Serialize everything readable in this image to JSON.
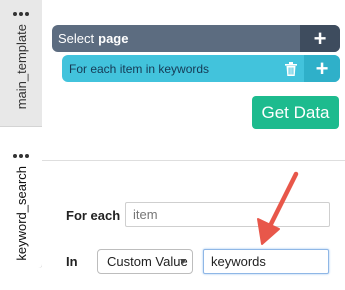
{
  "tabs": {
    "main_template": "main_template",
    "keyword_search": "keyword_search"
  },
  "select_bar": {
    "prefix": "Select",
    "target": "page",
    "plus_label": "+"
  },
  "foreach_bar": {
    "text": "For each item in keywords",
    "plus_label": "+"
  },
  "get_data_button": "Get Data",
  "form": {
    "for_each_label": "For each",
    "for_each_value": "item",
    "in_label": "In",
    "source_select": "Custom Value",
    "source_value": "keywords"
  },
  "colors": {
    "select_bar": "#5c6c80",
    "foreach_bar": "#42c3dc",
    "get_data": "#1dbb8e",
    "arrow": "#e8574a"
  },
  "icons": {
    "menu": "dots-icon",
    "delete": "trash-icon",
    "add": "plus-icon",
    "callout": "arrow-icon"
  }
}
